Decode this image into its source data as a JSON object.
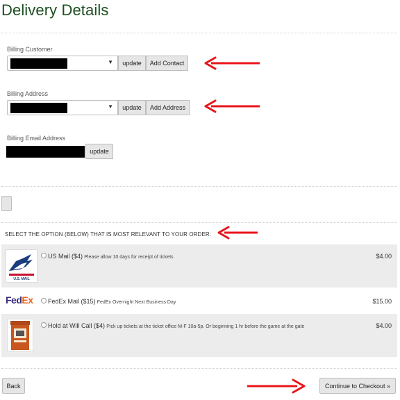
{
  "page": {
    "title": "Delivery Details"
  },
  "billing_customer": {
    "label": "Billing Customer",
    "update_label": "update",
    "add_label": "Add Contact"
  },
  "billing_address": {
    "label": "Billing Address",
    "update_label": "update",
    "add_label": "Add Address"
  },
  "billing_email": {
    "label": "Billing Email Address",
    "update_label": "update"
  },
  "shipping": {
    "instruction": "SELECT THE OPTION (BELOW) THAT IS MOST RELEVANT TO YOUR ORDER:",
    "options": [
      {
        "name": "US Mail ($4)",
        "description": "Please allow 10 days for receipt of tickets",
        "price": "$4.00",
        "logo_text": "U.S. MAIL"
      },
      {
        "name": "FedEx Mail ($15)",
        "description": "FedEx Overnight Next Business Day",
        "price": "$15.00",
        "logo_fed": "Fed",
        "logo_ex": "Ex"
      },
      {
        "name": "Hold at Will Call ($4)",
        "description": "Pick up tickets at the ticket office M-F 10a-5p. Or beginning 1 hr before the game at the gate",
        "price": "$4.00"
      }
    ]
  },
  "footer": {
    "back_label": "Back",
    "continue_label": "Continue to Checkout »"
  },
  "colors": {
    "title_green": "#1d4e22",
    "arrow_red": "#e8151b",
    "button_gray": "#e6e6e6",
    "row_shade": "#ececec"
  }
}
